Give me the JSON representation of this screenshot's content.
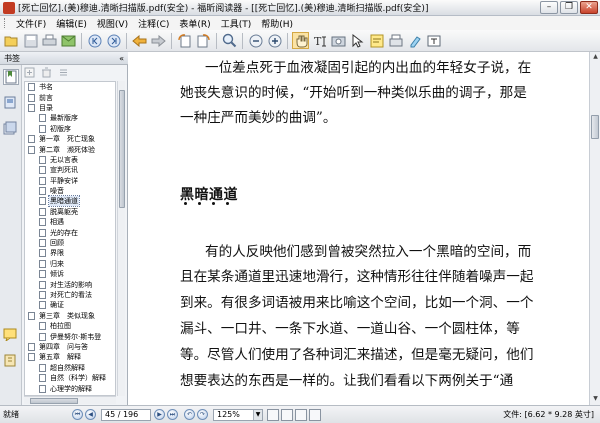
{
  "window": {
    "title": "[死亡回忆].(美)穆迪.清晰扫描版.pdf(安全) - 福昕阅读器 - [[死亡回忆].(美)穆迪.清晰扫描版.pdf(安全)]",
    "buttons": [
      "minimize",
      "restore",
      "close"
    ]
  },
  "menu": {
    "items": [
      "文件(F)",
      "编辑(E)",
      "视图(V)",
      "注释(C)",
      "表单(R)",
      "工具(T)",
      "帮助(H)"
    ]
  },
  "toolbar": {
    "icons": [
      "open-icon",
      "save-icon",
      "print-icon",
      "email-icon",
      "first-page-icon",
      "last-page-icon",
      "back-icon",
      "forward-icon",
      "rotate-left-icon",
      "rotate-right-icon",
      "zoom-icon",
      "zoom-out-icon",
      "zoom-in-icon",
      "hand-tool-icon",
      "select-text-icon",
      "snapshot-icon",
      "select-annotation-icon",
      "note-icon",
      "typewriter-icon",
      "highlight-icon",
      "text-box-icon"
    ]
  },
  "sidebar": {
    "title": "书签",
    "collapse_glyph": "«",
    "bookmarks": [
      {
        "label": "书名",
        "indent": 0
      },
      {
        "label": "前言",
        "indent": 0
      },
      {
        "label": "目录",
        "indent": 0
      },
      {
        "label": "最新版序",
        "indent": 1
      },
      {
        "label": "初版序",
        "indent": 1
      },
      {
        "label": "第一章　死亡现象",
        "indent": 0
      },
      {
        "label": "第二章　濒死体验",
        "indent": 0
      },
      {
        "label": "无以言表",
        "indent": 1
      },
      {
        "label": "宣判死讯",
        "indent": 1
      },
      {
        "label": "平静安详",
        "indent": 1
      },
      {
        "label": "噪音",
        "indent": 1
      },
      {
        "label": "黑暗通道",
        "indent": 1,
        "selected": true
      },
      {
        "label": "脱离躯壳",
        "indent": 1
      },
      {
        "label": "相遇",
        "indent": 1
      },
      {
        "label": "光的存在",
        "indent": 1
      },
      {
        "label": "回顾",
        "indent": 1
      },
      {
        "label": "界限",
        "indent": 1
      },
      {
        "label": "归来",
        "indent": 1
      },
      {
        "label": "倾诉",
        "indent": 1
      },
      {
        "label": "对生活的影响",
        "indent": 1
      },
      {
        "label": "对死亡的看法",
        "indent": 1
      },
      {
        "label": "确证",
        "indent": 1
      },
      {
        "label": "第三章　类似现象",
        "indent": 0
      },
      {
        "label": "柏拉图",
        "indent": 1
      },
      {
        "label": "伊曼努尔·斯韦登",
        "indent": 1
      },
      {
        "label": "第四章　问与答",
        "indent": 0
      },
      {
        "label": "第五章　解释",
        "indent": 0
      },
      {
        "label": "超自然解释",
        "indent": 1
      },
      {
        "label": "自然（科学）解释",
        "indent": 1
      },
      {
        "label": "心理学的解释",
        "indent": 1
      }
    ]
  },
  "document": {
    "lines_top": [
      "一位差点死于血液凝固引起的内出血的年轻女子说，在",
      "她丧失意识的时候，“开始听到一种类似乐曲的调子，那是",
      "一种庄严而美妙的曲调”。"
    ],
    "heading": "黑暗通道",
    "lines_body": [
      "有的人反映他们感到曾被突然拉入一个黑暗的空间，而",
      "且在某条通道里迅速地滑行，这种情形往往伴随着噪声一起",
      "到来。有很多词语被用来比喻这个空间，比如一个洞、一个",
      "漏斗、一口井、一条下水道、一道山谷、一个圆柱体，等",
      "等。尽管人们使用了各种词汇来描述，但是毫无疑问，他们",
      "想要表达的东西是一样的。让我们看看以下两例关于“通"
    ]
  },
  "statusbar": {
    "ready": "就绪",
    "page_value": "45 / 196",
    "zoom_value": "125%",
    "file_info": "文件: [6.62 * 9.28 英寸]"
  }
}
